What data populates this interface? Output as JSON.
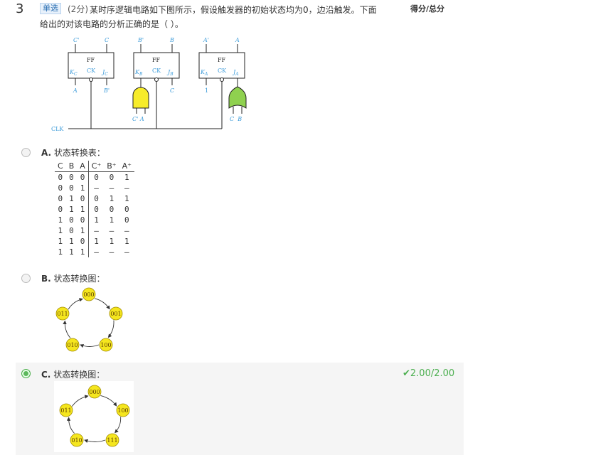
{
  "question": {
    "number": "3",
    "type": "单选",
    "points": "(2分)",
    "text_line1": "某时序逻辑电路如下图所示，假设触发器的初始状态均为0，边沿触发。下面",
    "text_line2": "给出的对该电路的分析正确的是（ ）。",
    "score_total_label": "得分/总分"
  },
  "circuit": {
    "ff_label": "FF",
    "ck": "CK",
    "ff1": {
      "top_left": "C'",
      "top_right": "C",
      "k": "K",
      "k_sub": "C",
      "j": "J",
      "j_sub": "C",
      "bottom_left": "A",
      "bottom_right": "B'"
    },
    "ff2": {
      "top_left": "B'",
      "top_right": "B",
      "k": "K",
      "k_sub": "B",
      "j": "J",
      "j_sub": "B",
      "bottom_right": "C"
    },
    "ff3": {
      "top_left": "A'",
      "top_right": "A",
      "k": "K",
      "k_sub": "A",
      "j": "J",
      "j_sub": "A",
      "bottom_left": "1"
    },
    "and_inputs": "C' A",
    "or_inputs": "C  B",
    "clk": "CLK",
    "and_color": "#f7ec2a",
    "or_color": "#8fd14f"
  },
  "options": {
    "a": {
      "letter": "A.",
      "text": "状态转换表：",
      "header": [
        "C",
        "B",
        "A",
        "C⁺",
        "B⁺",
        "A⁺"
      ],
      "rows": [
        [
          "0",
          "0",
          "0",
          "0",
          "0",
          "1"
        ],
        [
          "0",
          "0",
          "1",
          "–",
          "–",
          "–"
        ],
        [
          "0",
          "1",
          "0",
          "0",
          "1",
          "1"
        ],
        [
          "0",
          "1",
          "1",
          "0",
          "0",
          "0"
        ],
        [
          "1",
          "0",
          "0",
          "1",
          "1",
          "0"
        ],
        [
          "1",
          "0",
          "1",
          "–",
          "–",
          "–"
        ],
        [
          "1",
          "1",
          "0",
          "1",
          "1",
          "1"
        ],
        [
          "1",
          "1",
          "1",
          "–",
          "–",
          "–"
        ]
      ]
    },
    "b": {
      "letter": "B.",
      "text": "状态转换图：",
      "states": [
        "000",
        "001",
        "100",
        "010",
        "011"
      ]
    },
    "c": {
      "letter": "C.",
      "text": "状态转换图：",
      "states": [
        "000",
        "100",
        "111",
        "010",
        "011"
      ],
      "grade": "2.00/2.00"
    }
  },
  "colors": {
    "state_fill": "#f5e61e",
    "state_stroke": "#a08a00",
    "correct": "#4caf50"
  }
}
